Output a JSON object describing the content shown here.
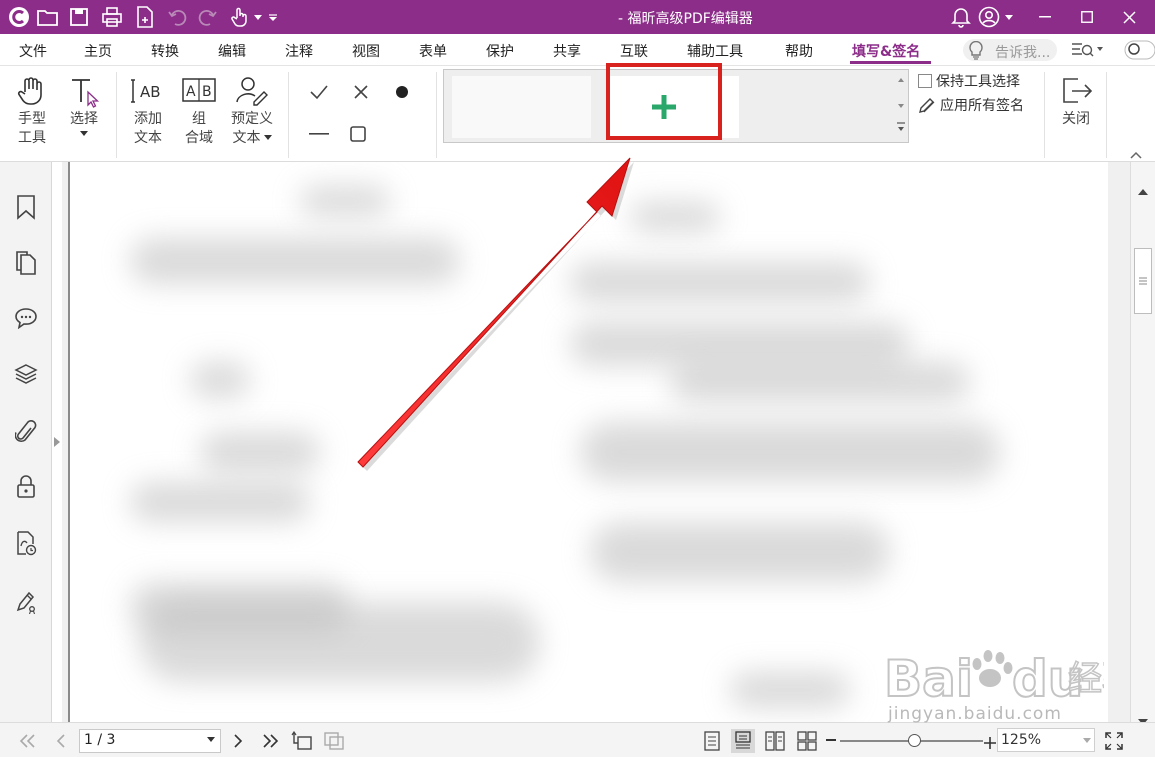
{
  "window": {
    "title": "- 福昕高级PDF编辑器",
    "accent_color": "#8c2d8a",
    "quick_access_icons": [
      "app-logo-icon",
      "open-folder-icon",
      "save-icon",
      "print-icon",
      "new-file-icon",
      "undo-icon",
      "redo-icon",
      "hand-cursor-icon",
      "customize-icon"
    ],
    "controls": [
      "notification-bell-icon",
      "user-account-icon",
      "minimize-icon",
      "maximize-icon",
      "close-icon"
    ]
  },
  "menu": {
    "items": [
      {
        "label": "文件"
      },
      {
        "label": "主页"
      },
      {
        "label": "转换"
      },
      {
        "label": "编辑"
      },
      {
        "label": "注释"
      },
      {
        "label": "视图"
      },
      {
        "label": "表单"
      },
      {
        "label": "保护"
      },
      {
        "label": "共享"
      },
      {
        "label": "互联"
      },
      {
        "label": "辅助工具"
      },
      {
        "label": "帮助"
      },
      {
        "label": "填写&签名"
      }
    ],
    "active_index": 12,
    "tell_me_placeholder": "告诉我..."
  },
  "ribbon": {
    "hand_tool": {
      "line1": "手型",
      "line2": "工具"
    },
    "select_tool": {
      "line1": "选择"
    },
    "add_text": {
      "line1": "添加",
      "line2": "文本"
    },
    "combine_fields": {
      "line1": "组",
      "line2": "合域"
    },
    "predefined_text": {
      "line1": "预定义",
      "line2": "文本"
    },
    "shape_tools": [
      "checkmark-icon",
      "cross-icon",
      "dot-icon",
      "line-icon",
      "rectangle-icon"
    ],
    "signature_gallery": {
      "add_signature_icon": "plus-icon",
      "add_color": "#2aa86b",
      "highlight_color": "#d8221d"
    },
    "keep_tool_selected": "保持工具选择",
    "apply_all_signatures": "应用所有签名",
    "close_label": "关闭"
  },
  "sidebar": {
    "icons": [
      "bookmark-icon",
      "pages-icon",
      "comments-icon",
      "layers-icon",
      "attachment-icon",
      "security-icon",
      "digital-signature-icon",
      "sign-pen-icon"
    ]
  },
  "status": {
    "page_display": "1 / 3",
    "zoom": "125%",
    "zoom_fraction": 0.52
  },
  "watermark": {
    "text": "jingyan.baidu.com"
  }
}
